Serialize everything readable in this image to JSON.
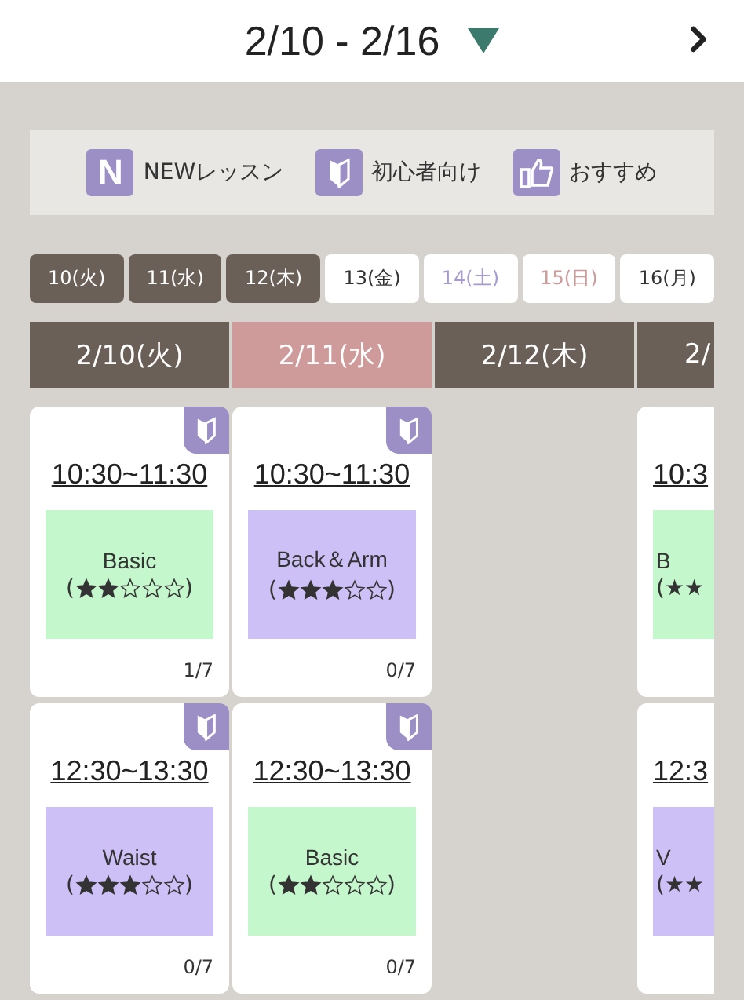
{
  "header": {
    "title": "2/10 - 2/16"
  },
  "legend": [
    {
      "kind": "new",
      "label": "NEWレッスン",
      "glyph": "N"
    },
    {
      "kind": "beginner",
      "label": "初心者向け"
    },
    {
      "kind": "recommended",
      "label": "おすすめ"
    }
  ],
  "day_tabs": [
    {
      "label": "10(火)",
      "kind": "past"
    },
    {
      "label": "11(水)",
      "kind": "past"
    },
    {
      "label": "12(木)",
      "kind": "past"
    },
    {
      "label": "13(金)",
      "kind": "weekday"
    },
    {
      "label": "14(土)",
      "kind": "saturday"
    },
    {
      "label": "15(日)",
      "kind": "holiday"
    },
    {
      "label": "16(月)",
      "kind": "weekday"
    }
  ],
  "columns": [
    {
      "header": "2/10(火)",
      "kind": "normal",
      "lessons": [
        {
          "time": "10:30~11:30",
          "title": "Basic",
          "stars": 2,
          "brackets": [
            "(",
            ")"
          ],
          "color": "#c4f7cc",
          "beginner": true,
          "count": "1/7"
        },
        {
          "time": "12:30~13:30",
          "title": "Waist",
          "stars": 3,
          "brackets": [
            "(",
            ")"
          ],
          "color": "#cdc0f7",
          "beginner": true,
          "count": "0/7"
        }
      ]
    },
    {
      "header": "2/11(水)",
      "kind": "holiday",
      "lessons": [
        {
          "time": "10:30~11:30",
          "title": "Back＆Arm",
          "stars": 3,
          "brackets": [
            "(",
            ")"
          ],
          "color": "#cdc0f7",
          "beginner": true,
          "count": "0/7"
        },
        {
          "time": "12:30~13:30",
          "title": "Basic",
          "stars": 2,
          "brackets": [
            "(",
            ")"
          ],
          "color": "#c4f7cc",
          "beginner": true,
          "count": "0/7"
        }
      ]
    },
    {
      "header": "2/12(木)",
      "kind": "normal"
    },
    {
      "header": "2/",
      "kind": "normal",
      "lessons": [
        {
          "time": "10:3",
          "title": "B",
          "rating_text": "(★★",
          "color": "#c4f7cc"
        },
        {
          "time": "12:3",
          "title": "V",
          "rating_text": "(★★",
          "color": "#cdc0f7"
        }
      ]
    }
  ]
}
